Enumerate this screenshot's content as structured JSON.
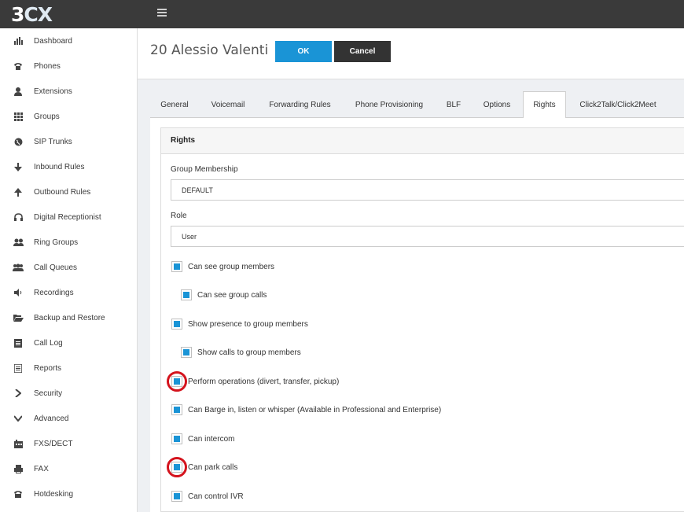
{
  "app": {
    "logo_text_a": "3",
    "logo_text_b": "CX"
  },
  "sidebar": {
    "items": [
      {
        "label": "Dashboard",
        "icon": "bar-chart-icon"
      },
      {
        "label": "Phones",
        "icon": "phone-icon"
      },
      {
        "label": "Extensions",
        "icon": "user-icon"
      },
      {
        "label": "Groups",
        "icon": "grid-icon"
      },
      {
        "label": "SIP Trunks",
        "icon": "globe-icon"
      },
      {
        "label": "Inbound Rules",
        "icon": "arrow-down-icon"
      },
      {
        "label": "Outbound Rules",
        "icon": "arrow-up-icon"
      },
      {
        "label": "Digital Receptionist",
        "icon": "headset-icon"
      },
      {
        "label": "Ring Groups",
        "icon": "users-icon"
      },
      {
        "label": "Call Queues",
        "icon": "queue-users-icon"
      },
      {
        "label": "Recordings",
        "icon": "speaker-icon"
      },
      {
        "label": "Backup and Restore",
        "icon": "folder-open-icon"
      },
      {
        "label": "Call Log",
        "icon": "log-icon"
      },
      {
        "label": "Reports",
        "icon": "report-icon"
      },
      {
        "label": "Security",
        "icon": "chevron-right-icon"
      },
      {
        "label": "Advanced",
        "icon": "chevron-down-icon"
      },
      {
        "label": "FXS/DECT",
        "icon": "fxs-device-icon"
      },
      {
        "label": "FAX",
        "icon": "fax-icon"
      },
      {
        "label": "Hotdesking",
        "icon": "desk-phone-icon"
      }
    ]
  },
  "header": {
    "title": "20 Alessio Valenti",
    "ok_label": "OK",
    "cancel_label": "Cancel"
  },
  "tabs": [
    {
      "label": "General"
    },
    {
      "label": "Voicemail"
    },
    {
      "label": "Forwarding Rules"
    },
    {
      "label": "Phone Provisioning"
    },
    {
      "label": "BLF"
    },
    {
      "label": "Options"
    },
    {
      "label": "Rights",
      "active": true
    },
    {
      "label": "Click2Talk/Click2Meet"
    }
  ],
  "rights": {
    "section_title": "Rights",
    "group_membership_label": "Group Membership",
    "group_membership_value": "DEFAULT",
    "role_label": "Role",
    "role_value": "User",
    "checkboxes": [
      {
        "label": "Can see group members",
        "checked": true
      },
      {
        "label": "Can see group calls",
        "checked": true
      },
      {
        "label": "Show presence to group members",
        "checked": true
      },
      {
        "label": "Show calls to group members",
        "checked": true
      },
      {
        "label": "Perform operations (divert, transfer, pickup)",
        "checked": true,
        "highlighted": true
      },
      {
        "label": "Can Barge in, listen or whisper (Available in Professional and Enterprise)",
        "checked": true
      },
      {
        "label": "Can intercom",
        "checked": true
      },
      {
        "label": "Can park calls",
        "checked": true,
        "highlighted": true
      },
      {
        "label": "Can control IVR",
        "checked": true
      }
    ]
  },
  "colors": {
    "accent": "#1a94d6",
    "topbar": "#3a3a3a",
    "annotation": "#d4131d"
  }
}
